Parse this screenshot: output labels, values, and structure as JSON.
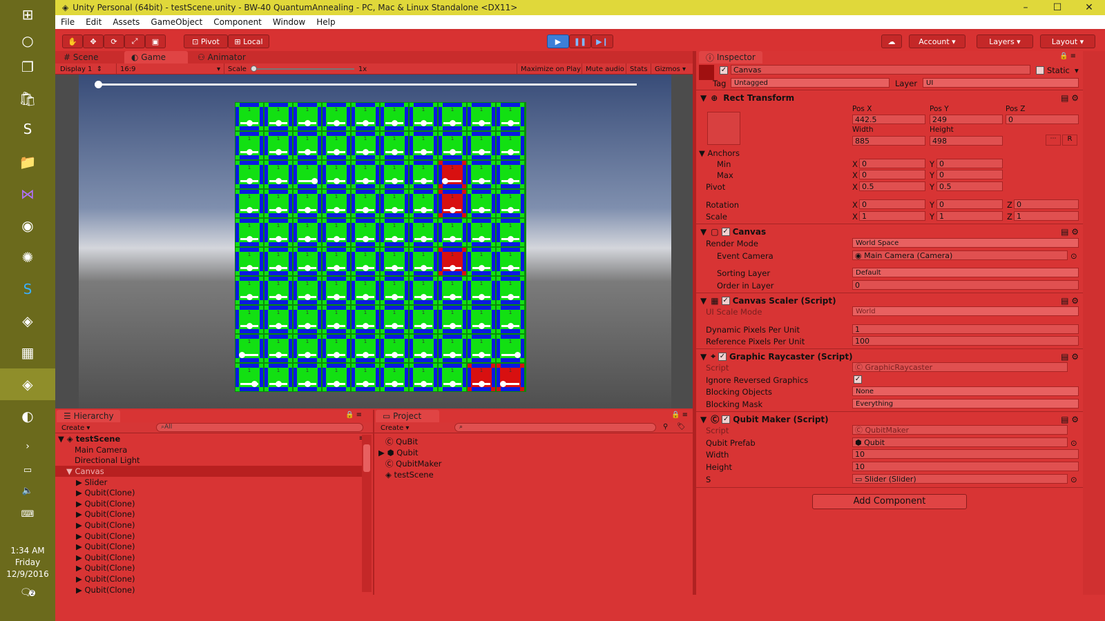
{
  "window": {
    "title": "Unity Personal (64bit) - testScene.unity - BW-40 QuantumAnnealing - PC, Mac & Linux Standalone <DX11>",
    "controls": [
      "–",
      "☐",
      "✕"
    ]
  },
  "taskbar": {
    "clock_time": "1:34 AM",
    "clock_day": "Friday",
    "clock_date": "12/9/2016",
    "notification_count": "2"
  },
  "menu": [
    "File",
    "Edit",
    "Assets",
    "GameObject",
    "Component",
    "Window",
    "Help"
  ],
  "toolbar": {
    "pivot": "Pivot",
    "local": "Local",
    "account": "Account",
    "layers": "Layers",
    "layout": "Layout"
  },
  "game_view": {
    "tabs": [
      "Scene",
      "Game",
      "Animator"
    ],
    "display": "Display 1",
    "aspect": "16:9",
    "scale_label": "Scale",
    "scale_value": "1x",
    "maximize": "Maximize on Play",
    "mute": "Mute audio",
    "stats": "Stats",
    "gizmos": "Gizmos",
    "grid_cell_label": "1",
    "grid_rows": 10,
    "grid_cols": 10,
    "red_cells": [
      [
        2,
        7
      ],
      [
        3,
        7
      ],
      [
        5,
        7
      ],
      [
        9,
        8
      ],
      [
        9,
        9
      ]
    ],
    "slider_positions": [
      [
        0.5,
        0.5,
        0.5,
        0.5,
        0.5,
        0.5,
        0.5,
        0.5,
        0.5,
        0.5
      ],
      [
        0.5,
        0.5,
        0.5,
        0.5,
        0.5,
        0.5,
        0.5,
        0.5,
        0.5,
        0.5
      ],
      [
        0.5,
        0.5,
        0.9,
        0.5,
        0.5,
        0.5,
        0.5,
        0.1,
        0.5,
        0.5
      ],
      [
        0.5,
        0.5,
        0.5,
        0.5,
        0.5,
        0.5,
        0.5,
        0.5,
        0.5,
        0.5
      ],
      [
        0.5,
        0.5,
        0.5,
        0.5,
        0.5,
        0.5,
        0.5,
        0.5,
        0.5,
        0.5
      ],
      [
        0.5,
        0.5,
        0.5,
        0.5,
        0.5,
        0.5,
        0.5,
        0.5,
        0.5,
        0.5
      ],
      [
        0.5,
        0.5,
        0.5,
        0.5,
        0.5,
        0.5,
        0.5,
        0.5,
        0.5,
        0.5
      ],
      [
        0.5,
        0.5,
        0.5,
        0.5,
        0.5,
        0.5,
        0.5,
        0.5,
        0.5,
        0.5
      ],
      [
        0.1,
        0.5,
        0.5,
        0.5,
        0.5,
        0.5,
        0.5,
        0.5,
        0.5,
        0.9
      ],
      [
        0.8,
        0.5,
        0.5,
        0.5,
        0.5,
        0.5,
        0.5,
        0.5,
        0.5,
        0.1
      ]
    ],
    "top_slider_value": 0
  },
  "hierarchy": {
    "tab": "Hierarchy",
    "create": "Create",
    "search_placeholder": "All",
    "scene": "testScene",
    "items": [
      "Main Camera",
      "Directional Light",
      "Canvas",
      "Slider",
      "Qubit(Clone)",
      "Qubit(Clone)",
      "Qubit(Clone)",
      "Qubit(Clone)",
      "Qubit(Clone)",
      "Qubit(Clone)",
      "Qubit(Clone)",
      "Qubit(Clone)",
      "Qubit(Clone)",
      "Qubit(Clone)"
    ]
  },
  "project": {
    "tab": "Project",
    "create": "Create",
    "items": [
      "QuBit",
      "Qubit",
      "QubitMaker",
      "testScene"
    ]
  },
  "inspector": {
    "tab": "Inspector",
    "object_name": "Canvas",
    "static_label": "Static",
    "tag_label": "Tag",
    "tag_value": "Untagged",
    "layer_label": "Layer",
    "layer_value": "UI",
    "rect": {
      "header": "Rect Transform",
      "posx_label": "Pos X",
      "posy_label": "Pos Y",
      "posz_label": "Pos Z",
      "posx": "442.5",
      "posy": "249",
      "posz": "0",
      "width_label": "Width",
      "height_label": "Height",
      "width": "885",
      "height": "498",
      "anchors": "Anchors",
      "min": "Min",
      "max": "Max",
      "min_x": "0",
      "min_y": "0",
      "max_x": "0",
      "max_y": "0",
      "pivot": "Pivot",
      "pivot_x": "0.5",
      "pivot_y": "0.5",
      "rotation": "Rotation",
      "rot_x": "0",
      "rot_y": "0",
      "rot_z": "0",
      "scale": "Scale",
      "scale_x": "1",
      "scale_y": "1",
      "scale_z": "1",
      "x": "X",
      "y": "Y",
      "z": "Z",
      "r": "R"
    },
    "canvas": {
      "header": "Canvas",
      "render_mode_label": "Render Mode",
      "render_mode": "World Space",
      "event_camera_label": "Event Camera",
      "event_camera": "Main Camera (Camera)",
      "sorting_layer_label": "Sorting Layer",
      "sorting_layer": "Default",
      "order_label": "Order in Layer",
      "order": "0"
    },
    "scaler": {
      "header": "Canvas Scaler (Script)",
      "ui_scale_label": "UI Scale Mode",
      "ui_scale": "World",
      "dyn_label": "Dynamic Pixels Per Unit",
      "dyn": "1",
      "ref_label": "Reference Pixels Per Unit",
      "ref": "100"
    },
    "raycaster": {
      "header": "Graphic Raycaster (Script)",
      "script_label": "Script",
      "script": "GraphicRaycaster",
      "ignore_label": "Ignore Reversed Graphics",
      "blocking_label": "Blocking Objects",
      "blocking": "None",
      "mask_label": "Blocking Mask",
      "mask": "Everything"
    },
    "qubitmaker": {
      "header": "Qubit Maker (Script)",
      "script_label": "Script",
      "script": "QubitMaker",
      "prefab_label": "Qubit Prefab",
      "prefab": "Qubit",
      "width_label": "Width",
      "width": "10",
      "height_label": "Height",
      "height": "10",
      "s_label": "S",
      "s": "Slider (Slider)"
    },
    "add_component": "Add Component"
  }
}
